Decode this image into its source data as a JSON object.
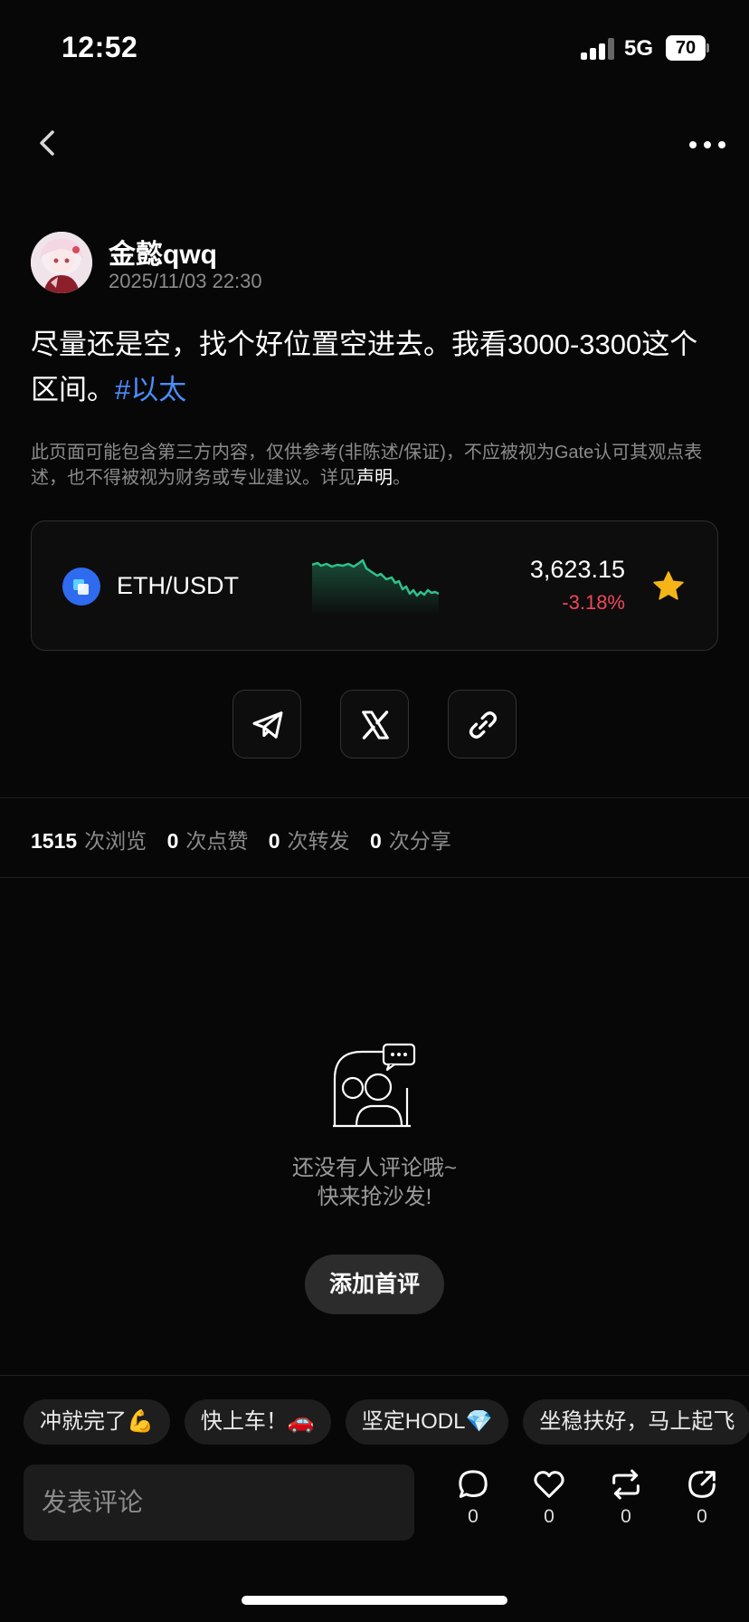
{
  "status_bar": {
    "time": "12:52",
    "network": "5G",
    "battery": "70"
  },
  "post": {
    "author": "金懿qwq",
    "timestamp": "2025/11/03 22:30",
    "content": "尽量还是空，找个好位置空进去。我看3000-3300这个区间。",
    "hashtag": "#以太"
  },
  "disclaimer": {
    "text": "此页面可能包含第三方内容，仅供参考(非陈述/保证)，不应被视为Gate认可其观点表述，也不得被视为财务或专业建议。详见",
    "link": "声明",
    "end": "。"
  },
  "ticker": {
    "pair": "ETH/USDT",
    "price": "3,623.15",
    "change": "-3.18%",
    "colors": {
      "down": "#f0465c",
      "sparkline": "#2fc28a",
      "star": "#f5b518",
      "coin": "#2f6bf0"
    }
  },
  "share": {
    "icons": [
      "telegram-icon",
      "x-logo-icon",
      "link-icon"
    ]
  },
  "stats": {
    "views": "1515",
    "views_label": "次浏览",
    "likes": "0",
    "likes_label": "次点赞",
    "reposts": "0",
    "reposts_label": "次转发",
    "shares": "0",
    "shares_label": "次分享"
  },
  "empty_state": {
    "line1": "还没有人评论哦~",
    "line2": "快来抢沙发!",
    "button": "添加首评"
  },
  "quick_replies": [
    "冲就完了💪",
    "快上车！🚗",
    "坚定HODL💎",
    "坐稳扶好，马上起飞"
  ],
  "comment_bar": {
    "placeholder": "发表评论",
    "comment_count": "0",
    "like_count": "0",
    "repost_count": "0",
    "share_count": "0"
  }
}
